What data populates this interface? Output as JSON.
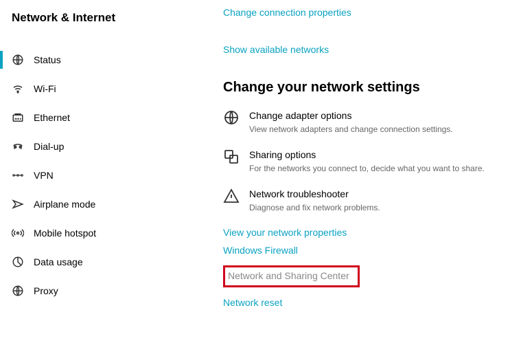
{
  "sidebar": {
    "title": "Network & Internet",
    "items": [
      {
        "label": "Status",
        "icon": "status-icon"
      },
      {
        "label": "Wi-Fi",
        "icon": "wifi-icon"
      },
      {
        "label": "Ethernet",
        "icon": "ethernet-icon"
      },
      {
        "label": "Dial-up",
        "icon": "dialup-icon"
      },
      {
        "label": "VPN",
        "icon": "vpn-icon"
      },
      {
        "label": "Airplane mode",
        "icon": "airplane-icon"
      },
      {
        "label": "Mobile hotspot",
        "icon": "hotspot-icon"
      },
      {
        "label": "Data usage",
        "icon": "datausage-icon"
      },
      {
        "label": "Proxy",
        "icon": "proxy-icon"
      }
    ]
  },
  "main": {
    "top_links": {
      "change_conn": "Change connection properties",
      "show_networks": "Show available networks"
    },
    "section_heading": "Change your network settings",
    "settings": [
      {
        "title": "Change adapter options",
        "desc": "View network adapters and change connection settings."
      },
      {
        "title": "Sharing options",
        "desc": "For the networks you connect to, decide what you want to share."
      },
      {
        "title": "Network troubleshooter",
        "desc": "Diagnose and fix network problems."
      }
    ],
    "bottom_links": {
      "view_props": "View your network properties",
      "firewall": "Windows Firewall",
      "sharing_center": "Network and Sharing Center",
      "reset": "Network reset"
    }
  }
}
